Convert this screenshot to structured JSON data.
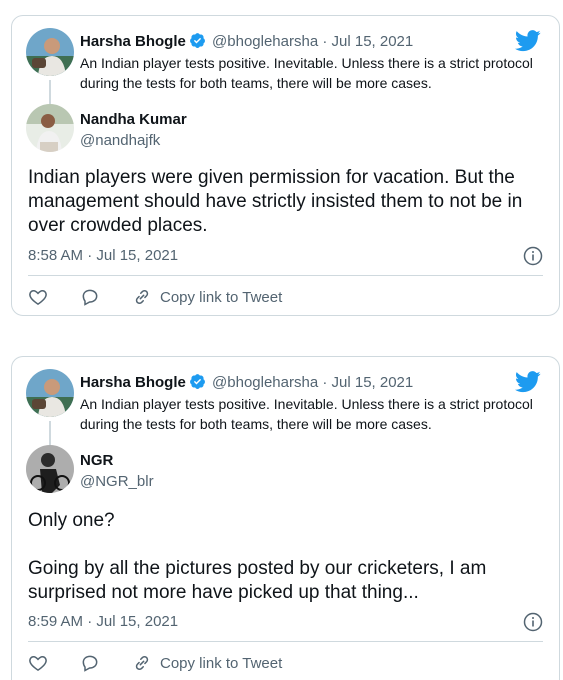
{
  "tweets": [
    {
      "parent": {
        "name": "Harsha Bhogle",
        "handle": "@bhogleharsha",
        "separator": "·",
        "date": "Jul 15, 2021",
        "text": "An Indian player tests positive. Inevitable. Unless there is a strict protocol during the tests for both teams, there will be more cases."
      },
      "reply": {
        "name": "Nandha Kumar",
        "handle": "@nandhajfk",
        "text": "Indian players were given permission for vacation. But the management should have strictly insisted them to not be in over crowded places.",
        "timestamp": "8:58 AM · Jul 15, 2021"
      },
      "actions": {
        "copy_link_label": "Copy link to Tweet"
      }
    },
    {
      "parent": {
        "name": "Harsha Bhogle",
        "handle": "@bhogleharsha",
        "separator": "·",
        "date": "Jul 15, 2021",
        "text": "An Indian player tests positive. Inevitable. Unless there is a strict protocol during the tests for both teams, there will be more cases."
      },
      "reply": {
        "name": "NGR",
        "handle": "@NGR_blr",
        "text_line1": "Only one?",
        "text_line2": "Going by all the pictures posted by our cricketers, I am surprised not more have picked up that thing...",
        "timestamp": "8:59 AM · Jul 15, 2021"
      },
      "actions": {
        "copy_link_label": "Copy link to Tweet"
      }
    }
  ],
  "colors": {
    "twitter_blue": "#1d9bf0",
    "verified_blue": "#1d9bf0",
    "secondary_text": "#536471",
    "border": "#cfd9de"
  },
  "icons": [
    "twitter-logo-icon",
    "verified-badge-icon",
    "info-icon",
    "heart-icon",
    "reply-bubble-icon",
    "link-icon"
  ]
}
